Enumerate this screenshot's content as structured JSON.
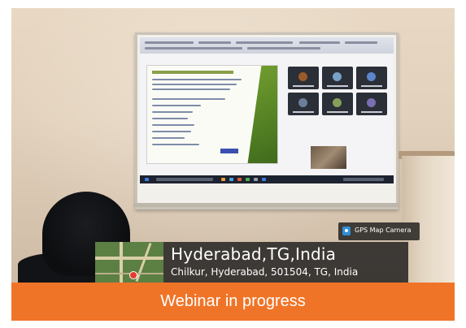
{
  "photo": {
    "stamp": {
      "app_label": "GPS Map Camera",
      "location_title": "Hyderabad,TG,India",
      "address": "Chilkur, Hyderabad, 501504, TG, India"
    }
  },
  "caption": {
    "text": "Webinar in progress",
    "background_color": "#f07427",
    "text_color": "#ffffff"
  }
}
